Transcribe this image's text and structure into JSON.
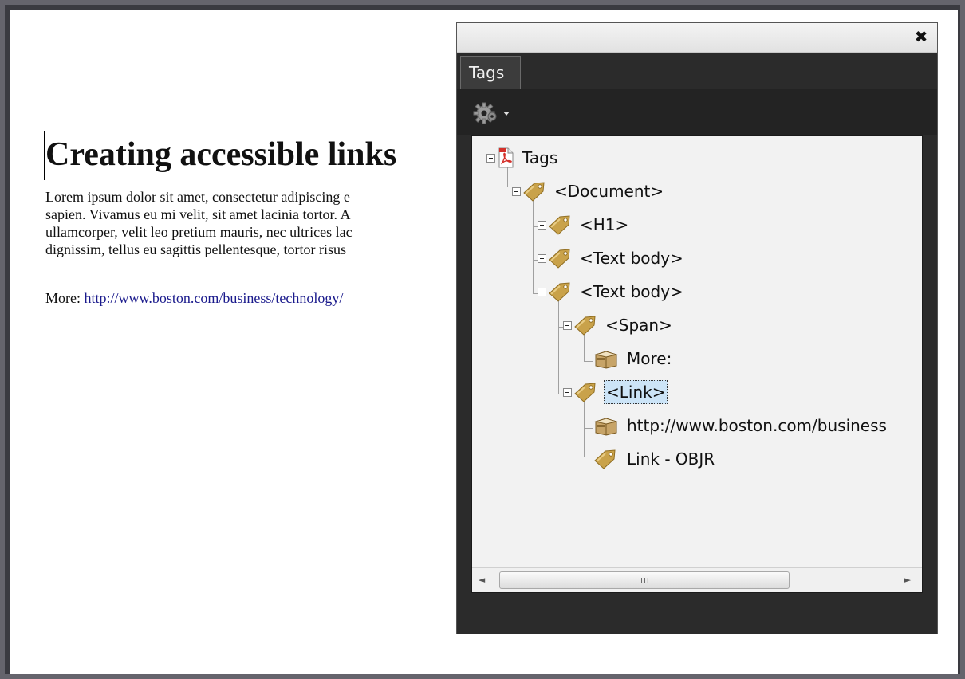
{
  "document": {
    "heading": "Creating accessible links",
    "paragraph_lines": [
      "Lorem ipsum dolor sit amet, consectetur adipiscing e",
      "sapien. Vivamus eu mi velit, sit amet lacinia tortor. A",
      "ullamcorper, velit leo pretium mauris, nec ultrices lac",
      "dignissim, tellus eu sagittis pellentesque, tortor risus"
    ],
    "more_label": "More: ",
    "more_link": "http://www.boston.com/business/technology/"
  },
  "panel": {
    "close_glyph": "✖",
    "tab_label": "Tags",
    "options_icon": "gear-icon",
    "scroll_grip": "III",
    "scroll_left": "◄",
    "scroll_right": "►"
  },
  "tree": {
    "root": "Tags",
    "document": "<Document>",
    "h1": "<H1>",
    "text_body_1": "<Text body>",
    "text_body_2": "<Text body>",
    "span": "<Span>",
    "more": "More:",
    "link": "<Link>",
    "url": "http://www.boston.com/business",
    "objr": "Link - OBJR"
  },
  "colors": {
    "tag_icon": "#c9a24a",
    "pdf_icon": "#d4302a",
    "selection": "#cce4f7",
    "link_text": "#1a1a8c"
  }
}
